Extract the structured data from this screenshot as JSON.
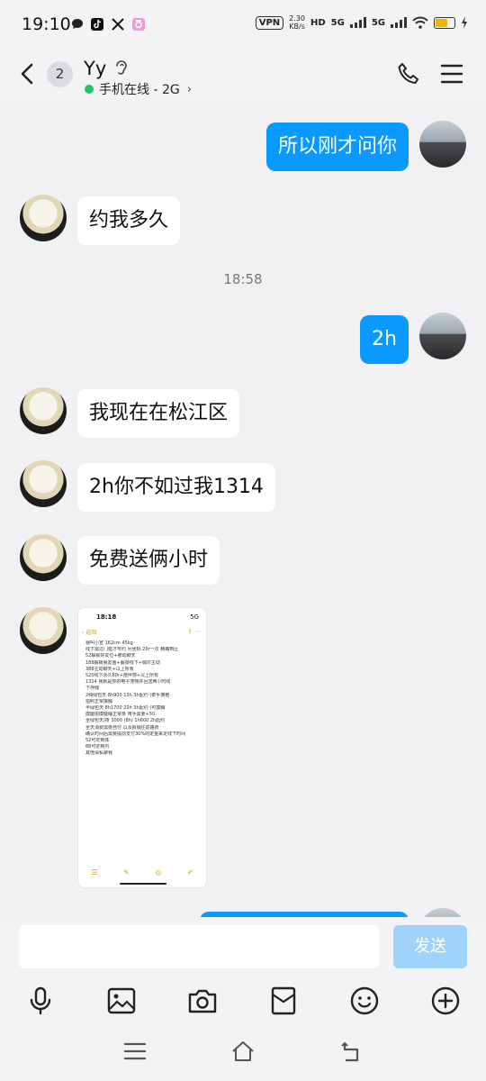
{
  "status_bar": {
    "time": "19:10",
    "vpn": "VPN",
    "speed_value": "2.30",
    "speed_unit": "KB/s",
    "hd": "HD",
    "network1": "5G",
    "network2": "5G",
    "battery_color": "#f5b400"
  },
  "header": {
    "unread_count": "2",
    "contact_name": "Yy",
    "online_status": "手机在线 - 2G",
    "status_dot_color": "#22c55e"
  },
  "messages": [
    {
      "side": "out",
      "text": "所以刚才问你"
    },
    {
      "side": "in",
      "text": "约我多久"
    },
    {
      "type": "timestamp",
      "text": "18:58"
    },
    {
      "side": "out",
      "text": "2h"
    },
    {
      "side": "in",
      "text": "我现在在松江区"
    },
    {
      "side": "in",
      "text": "2h你不如过我1314"
    },
    {
      "side": "in",
      "text": "免费送俩小时"
    },
    {
      "side": "in",
      "type": "image",
      "screenshot": {
        "time": "18:18",
        "status": "5G",
        "back": "返回",
        "lines": [
          "我叫小宣 162cm 45kg",
          "线下需过门槛才可约 问坐标 20r一次 精确到区",
          "52解锁好友位+被动聊天",
          "188解锁朋友圈+解锁线下+偶尔主动",
          "388主动聊天+以上所有",
          "520线下永久8折+陪伴感+以上所有",
          "1314 我就是你的电子宠物并且送两小时线",
          "下存储",
          "2纯绿包天 8h900 13h 3h起约 (牵手拥抱",
          "拍照正常接触",
          "半绿包天 8h1700 23h 3h起约 (可摸胸",
          "摸腿拍摸腿睡正常亲 用手需要+50",
          "全绿包天/夜 3000 (8h) 1h600 2h起约",
          "全天消费需要自付 以及报销往返路费",
          "确认时间后需要提前支付30%的定金来定线下时间",
          "52可定制体",
          "88可定制内",
          "其他请私聊我"
        ]
      }
    }
  ],
  "input": {
    "placeholder": "",
    "send_label": "发送"
  },
  "colors": {
    "outgoing_bubble": "#0a99ff",
    "incoming_bubble": "#ffffff",
    "background": "#f1f1f4",
    "send_button": "#9fd3fb"
  },
  "toolbar_icons": [
    "microphone-icon",
    "image-icon",
    "camera-icon",
    "red-packet-icon",
    "emoji-icon",
    "plus-icon"
  ],
  "nav_icons": [
    "menu-icon",
    "home-icon",
    "back-icon"
  ]
}
